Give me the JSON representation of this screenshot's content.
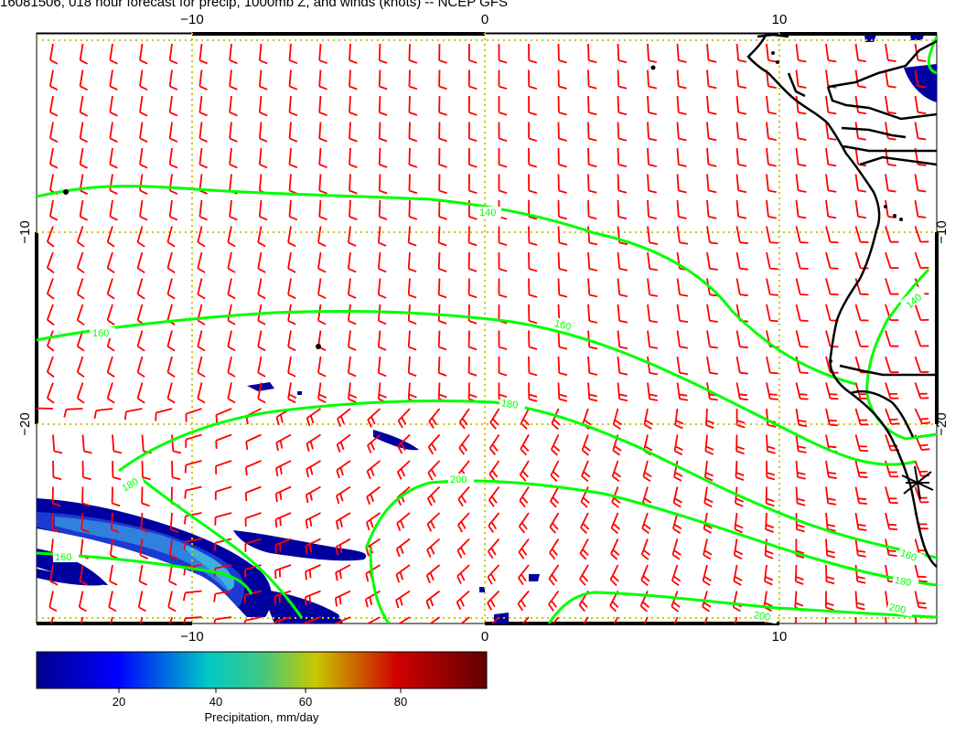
{
  "title": "16081506, 018 hour forecast for precip, 1000mb Z, and winds (knots) -- NCEP GFS",
  "map": {
    "lon_ticks_bottom": [
      "−10",
      "0",
      "10"
    ],
    "lon_ticks_top": [
      "−10",
      "0",
      "10"
    ],
    "lat_ticks_left": [
      "−10",
      "−20"
    ],
    "lat_ticks_right": [
      "−10",
      "−20"
    ]
  },
  "contour_labels": [
    "140",
    "140",
    "160",
    "160",
    "160",
    "180",
    "180",
    "180",
    "200",
    "160",
    "200",
    "200"
  ],
  "colorbar": {
    "ticks": [
      "20",
      "40",
      "60",
      "80"
    ],
    "label": "Precipitation, mm/day"
  },
  "colors": {
    "wind_barbs": "#ff0000",
    "contours": "#00ff00",
    "coast": "#000000",
    "grid": "#c8c800"
  }
}
